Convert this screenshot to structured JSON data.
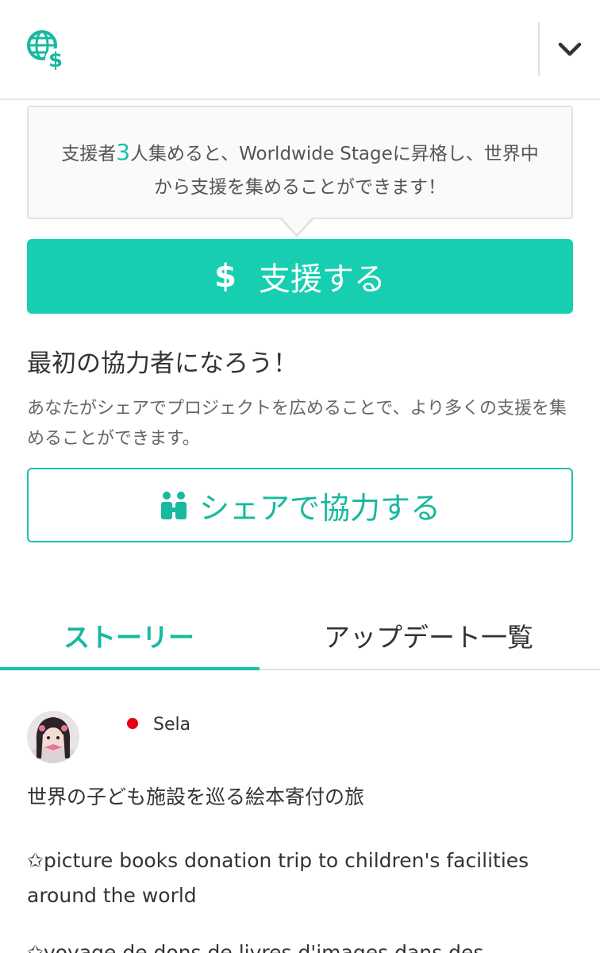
{
  "header": {
    "logo_icon": "globe-dollar-icon",
    "menu_icon": "chevron-down-icon"
  },
  "tooltip": {
    "text_before": "支援者",
    "supporters_needed": "3",
    "text_after": "人集めると、Worldwide Stageに昇格し、世界中から支援を集めることができます！"
  },
  "support_button": {
    "icon": "dollar-icon",
    "label": "支援する"
  },
  "cooperate": {
    "title": "最初の協力者になろう！",
    "description": "あなたがシェアでプロジェクトを広めることで、より多くの支援を集めることができます。"
  },
  "share_button": {
    "icon": "people-icon",
    "label": "シェアで協力する"
  },
  "tabs": [
    {
      "label": "ストーリー",
      "active": true
    },
    {
      "label": "アップデート一覧",
      "active": false
    }
  ],
  "story": {
    "author": "Sela",
    "author_flag": "japan-flag-icon",
    "title": "世界の子ども施設を巡る絵本寄付の旅",
    "paragraph_en": "✩picture books donation trip to children's facilities around the world",
    "paragraph_fr": "✩voyage de dons de livres d'images dans des"
  },
  "colors": {
    "accent": "#17cfb0",
    "accent_text": "#17b99f",
    "tooltip_bg": "#fafafa",
    "border": "#e2e2e2"
  }
}
